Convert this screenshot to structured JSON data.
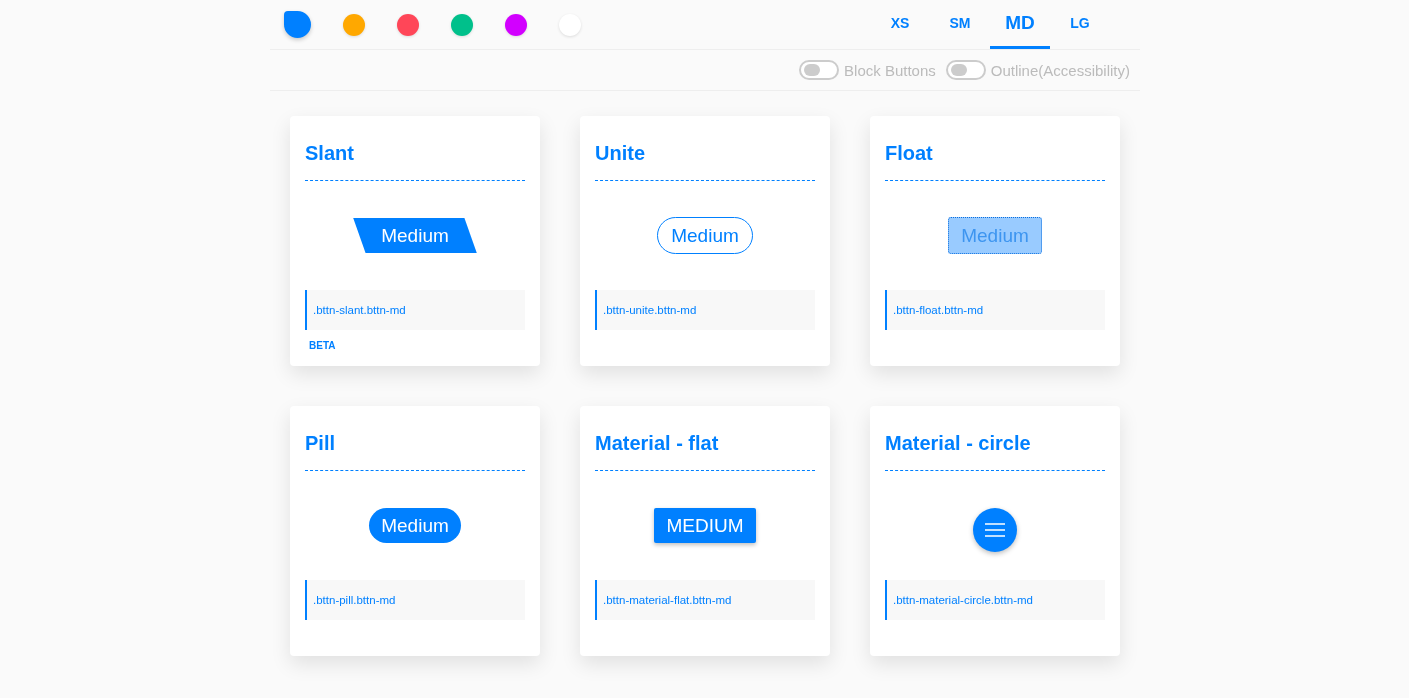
{
  "swatches": [
    {
      "color": "#0080ff",
      "selected": true
    },
    {
      "color": "#ffa800",
      "selected": false
    },
    {
      "color": "#ff4658",
      "selected": false
    },
    {
      "color": "#00c08b",
      "selected": false
    },
    {
      "color": "#d200ff",
      "selected": false
    },
    {
      "color": "#ffffff",
      "selected": false
    }
  ],
  "sizes": [
    {
      "label": "XS",
      "selected": false
    },
    {
      "label": "SM",
      "selected": false
    },
    {
      "label": "MD",
      "selected": true
    },
    {
      "label": "LG",
      "selected": false
    }
  ],
  "toggles": [
    {
      "label": "Block Buttons",
      "on": false
    },
    {
      "label": "Outline(Accessibility)",
      "on": false
    }
  ],
  "cards": [
    {
      "title": "Slant",
      "kind": "slant",
      "button": "Medium",
      "code": ".bttn-slant.bttn-md",
      "badge": "BETA"
    },
    {
      "title": "Unite",
      "kind": "unite",
      "button": "Medium",
      "code": ".bttn-unite.bttn-md"
    },
    {
      "title": "Float",
      "kind": "float",
      "button": "Medium",
      "code": ".bttn-float.bttn-md"
    },
    {
      "title": "Pill",
      "kind": "pill",
      "button": "Medium",
      "code": ".bttn-pill.bttn-md"
    },
    {
      "title": "Material - flat",
      "kind": "material-flat",
      "button": "MEDIUM",
      "code": ".bttn-material-flat.bttn-md"
    },
    {
      "title": "Material - circle",
      "kind": "material-circle",
      "code": ".bttn-material-circle.bttn-md"
    }
  ]
}
